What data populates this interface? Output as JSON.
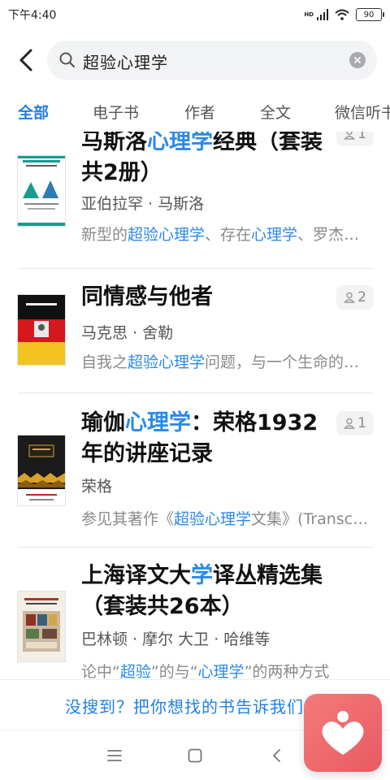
{
  "status_bar": {
    "time": "下午4:40",
    "network": "HD",
    "battery": "90"
  },
  "search": {
    "query": "超验心理学"
  },
  "tabs": [
    {
      "label": "全部",
      "active": true
    },
    {
      "label": "电子书",
      "active": false
    },
    {
      "label": "作者",
      "active": false
    },
    {
      "label": "全文",
      "active": false
    },
    {
      "label": "微信听书",
      "active": false
    }
  ],
  "results": [
    {
      "title_parts": [
        {
          "text": "马斯洛",
          "hl": false
        },
        {
          "text": "心理学",
          "hl": true
        },
        {
          "text": "经典（套装共2册）",
          "hl": false
        }
      ],
      "author": "亚伯拉罕 · 马斯洛",
      "snippet_parts": [
        {
          "text": "新型的",
          "hl": false
        },
        {
          "text": "超验心理学",
          "hl": true
        },
        {
          "text": "、存在",
          "hl": false
        },
        {
          "text": "心理学",
          "hl": true
        },
        {
          "text": "、罗杰斯的",
          "hl": false
        }
      ],
      "count": "1",
      "cover": {
        "title": "马斯洛心理学经典",
        "sub": "动机与人格 · 人性能达到的境界",
        "edition": "套装共2册",
        "bg": "#ffffff",
        "accent": "#1a9b8f"
      }
    },
    {
      "title_parts": [
        {
          "text": "同情感与他者",
          "hl": false
        }
      ],
      "author": "马克思 · 舍勒",
      "snippet_parts": [
        {
          "text": "自我之",
          "hl": false
        },
        {
          "text": "超验心理学",
          "hl": true
        },
        {
          "text": "问题，与一个生命的关系",
          "hl": false
        }
      ],
      "count": "2",
      "cover": {
        "title": "同情感与他者",
        "sub": "Max Scheler",
        "bg": "#d6171c",
        "accent": "#f3c320"
      }
    },
    {
      "title_parts": [
        {
          "text": "瑜伽",
          "hl": false
        },
        {
          "text": "心理学",
          "hl": true
        },
        {
          "text": "：荣格1932年的讲座记录",
          "hl": false
        }
      ],
      "author": "荣格",
      "snippet_parts": [
        {
          "text": "参见其著作《",
          "hl": false
        },
        {
          "text": "超验心理学",
          "hl": true
        },
        {
          "text": "文集》(Transcendent",
          "hl": false
        }
      ],
      "count": "1",
      "cover": {
        "title": "瑜伽心理学",
        "sub": "荣格1932年的讲座记录",
        "bg": "#1b1b1b",
        "accent": "#d8a22a"
      }
    },
    {
      "title_parts": [
        {
          "text": "上海译文大",
          "hl": false
        },
        {
          "text": "学",
          "hl": true
        },
        {
          "text": "译丛精选集（套装共26本）",
          "hl": false
        }
      ],
      "author": "巴林顿 · 摩尔 大卫 · 哈维等",
      "snippet_parts": [
        {
          "text": "论中“",
          "hl": false
        },
        {
          "text": "超验",
          "hl": true
        },
        {
          "text": "”的与“",
          "hl": false
        },
        {
          "text": "心理学",
          "hl": true
        },
        {
          "text": "”的两种方式",
          "hl": false
        }
      ],
      "count": "",
      "cover": {
        "title": "上海译文大学译丛精选集",
        "bg": "#f4efe6",
        "accent": "#a33a2a"
      }
    }
  ],
  "footer": {
    "hint": "没搜到？把你想找的书告诉我们"
  },
  "colors": {
    "accent": "#1f7fe6",
    "highlight": "#2b8ae8",
    "float_button": "#e85a62"
  }
}
